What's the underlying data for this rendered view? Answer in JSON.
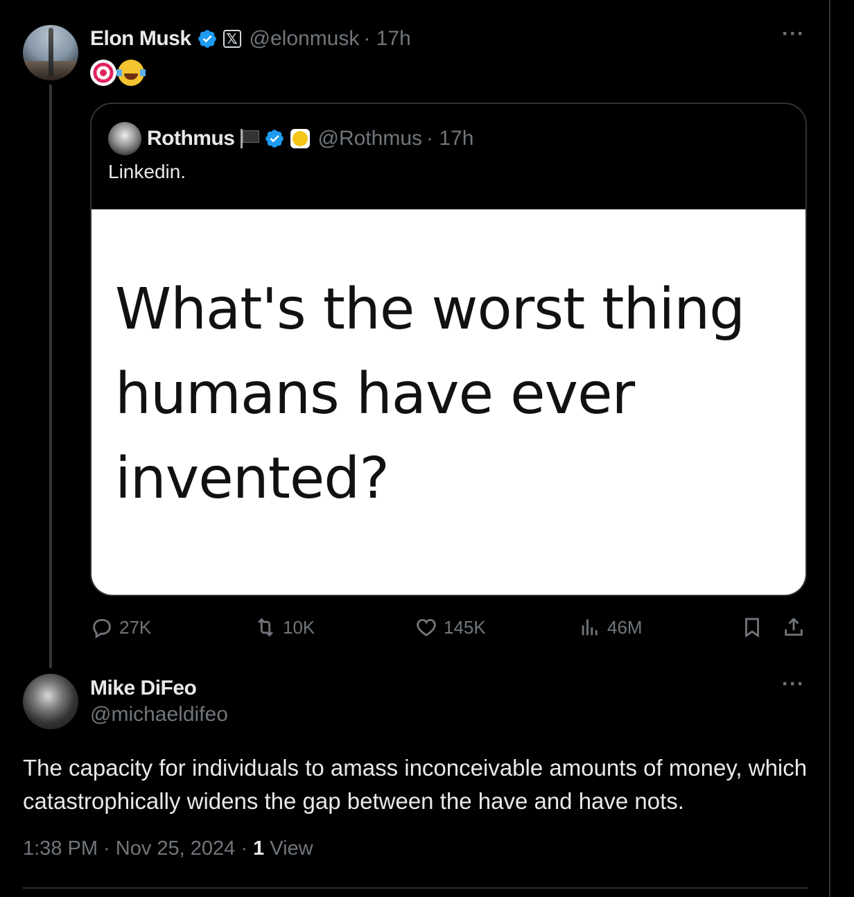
{
  "parent_tweet": {
    "name": "Elon Musk",
    "handle": "@elonmusk",
    "time": "· 17h",
    "emojis": [
      "target-emoji",
      "tears-of-joy-emoji"
    ],
    "more": "···"
  },
  "quoted_tweet": {
    "name": "Rothmus",
    "handle": "@Rothmus",
    "time": "· 17h",
    "text": "Linkedin.",
    "image_text": "What's the worst thing humans have ever invented?"
  },
  "actions": {
    "replies": "27K",
    "reposts": "10K",
    "likes": "145K",
    "views": "46M"
  },
  "reply_tweet": {
    "name": "Mike DiFeo",
    "handle": "@michaeldifeo",
    "more": "···",
    "text": "The capacity for individuals to amass inconceivable amounts of money, which catastrophically widens the gap between the have and have nots.",
    "time": "1:38 PM",
    "date": "Nov 25, 2024",
    "view_count": "1",
    "view_label": "View"
  },
  "colors": {
    "background": "#000000",
    "text": "#e7e9ea",
    "muted": "#71767b",
    "verified": "#1d9bf0",
    "border": "#2f3336"
  }
}
